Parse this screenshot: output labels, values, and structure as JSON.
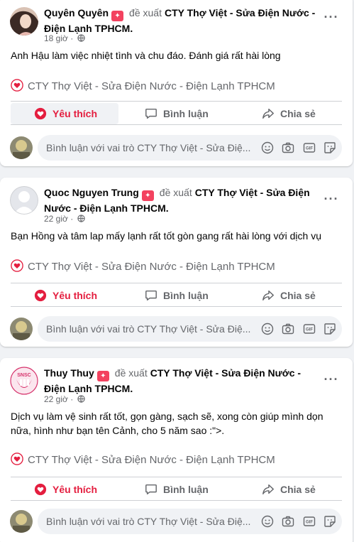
{
  "posts": [
    {
      "author": "Quyên Quyên",
      "verb": "đề xuất",
      "page": "CTY Thợ Việt - Sửa Điện Nước - Điện Lạnh TPHCM.",
      "time": "18 giờ",
      "text": "Anh Hậu làm việc nhiệt tình và chu đáo. Đánh giá rất hài lòng",
      "recommends": "CTY Thợ Việt - Sửa Điện Nước - Điện Lạnh TPHCM"
    },
    {
      "author": "Quoc Nguyen Trung",
      "verb": "đề xuất",
      "page": "CTY Thợ Việt - Sửa Điện Nước - Điện Lạnh TPHCM.",
      "time": "22 giờ",
      "text": "Bạn Hồng và tâm lap mấy lạnh rất tốt gòn gang rất hài lòng với dịch vụ",
      "recommends": "CTY Thợ Việt - Sửa Điện Nước - Điện Lạnh TPHCM"
    },
    {
      "author": "Thuy Thuy",
      "verb": "đề xuất",
      "page": "CTY Thợ Việt - Sửa Điện Nước - Điện Lạnh TPHCM.",
      "time": "22 giờ",
      "text": "Dịch vụ làm vệ sinh rất tốt, gọn gàng, sạch sẽ, xong còn giúp mình dọn nữa, hình như bạn tên Cảnh, cho 5 năm sao :\">.",
      "recommends": "CTY Thợ Việt - Sửa Điện Nước - Điện Lạnh TPHCM"
    }
  ],
  "actions": {
    "like": "Yêu thích",
    "comment": "Bình luận",
    "share": "Chia sẻ"
  },
  "comment_placeholder": "Bình luận với vai trò CTY Thợ Việt - Sửa Điệ...",
  "avatar_text": "SNSC",
  "icons": [
    "heart-outline-icon",
    "globe-icon",
    "more-icon",
    "like-heart-icon",
    "comment-icon",
    "share-icon",
    "emoji-icon",
    "camera-icon",
    "gif-icon",
    "sticker-icon"
  ],
  "colors": {
    "like": "#e41e3f",
    "badge": "#f3425f",
    "secondary_text": "#65676b"
  }
}
